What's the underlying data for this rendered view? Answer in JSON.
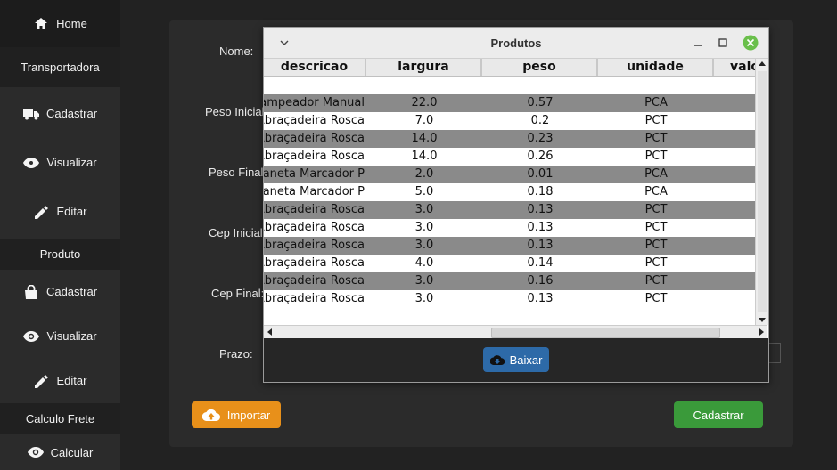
{
  "sidebar": {
    "home": "Home",
    "transportadora_header": "Transportadora",
    "transportadora_items": [
      "Cadastrar",
      "Visualizar",
      "Editar"
    ],
    "produto_header": "Produto",
    "produto_items": [
      "Cadastrar",
      "Visualizar",
      "Editar"
    ],
    "frete_header": "Calculo Frete",
    "frete_items": [
      "Calcular"
    ]
  },
  "form": {
    "labels": {
      "nome": "Nome:",
      "peso_inicial": "Peso Inicial:",
      "peso_final": "Peso Final:",
      "cep_inicial": "Cep Inicial:",
      "cep_final": "Cep Final:",
      "prazo": "Prazo:"
    },
    "importar_label": "Importar",
    "cadastrar_label": "Cadastrar"
  },
  "dialog": {
    "title": "Produtos",
    "columns": [
      "descricao",
      "largura",
      "peso",
      "unidade",
      "valor"
    ],
    "rows": [
      [
        "Grampeador Manual",
        "22.0",
        "0.57",
        "PCA"
      ],
      [
        "Abraçadeira Rosca",
        "7.0",
        "0.2",
        "PCT"
      ],
      [
        "Abraçadeira Rosca",
        "14.0",
        "0.23",
        "PCT"
      ],
      [
        "Abraçadeira Rosca",
        "14.0",
        "0.26",
        "PCT"
      ],
      [
        "Caneta Marcador P",
        "2.0",
        "0.01",
        "PCA"
      ],
      [
        "Caneta Marcador P",
        "5.0",
        "0.18",
        "PCA"
      ],
      [
        "Abraçadeira Rosca",
        "3.0",
        "0.13",
        "PCT"
      ],
      [
        "Abraçadeira Rosca",
        "3.0",
        "0.13",
        "PCT"
      ],
      [
        "Abraçadeira Rosca",
        "3.0",
        "0.13",
        "PCT"
      ],
      [
        "Abraçadeira Rosca",
        "4.0",
        "0.14",
        "PCT"
      ],
      [
        "Abraçadeira Rosca",
        "3.0",
        "0.16",
        "PCT"
      ],
      [
        "Abraçadeira Rosca",
        "3.0",
        "0.13",
        "PCT"
      ]
    ],
    "baixar_label": "Baixar"
  },
  "colors": {
    "importar": "#e8901a",
    "cadastrar": "#3a9a3a",
    "baixar": "#2d6aa8",
    "close": "#6abf4b"
  }
}
